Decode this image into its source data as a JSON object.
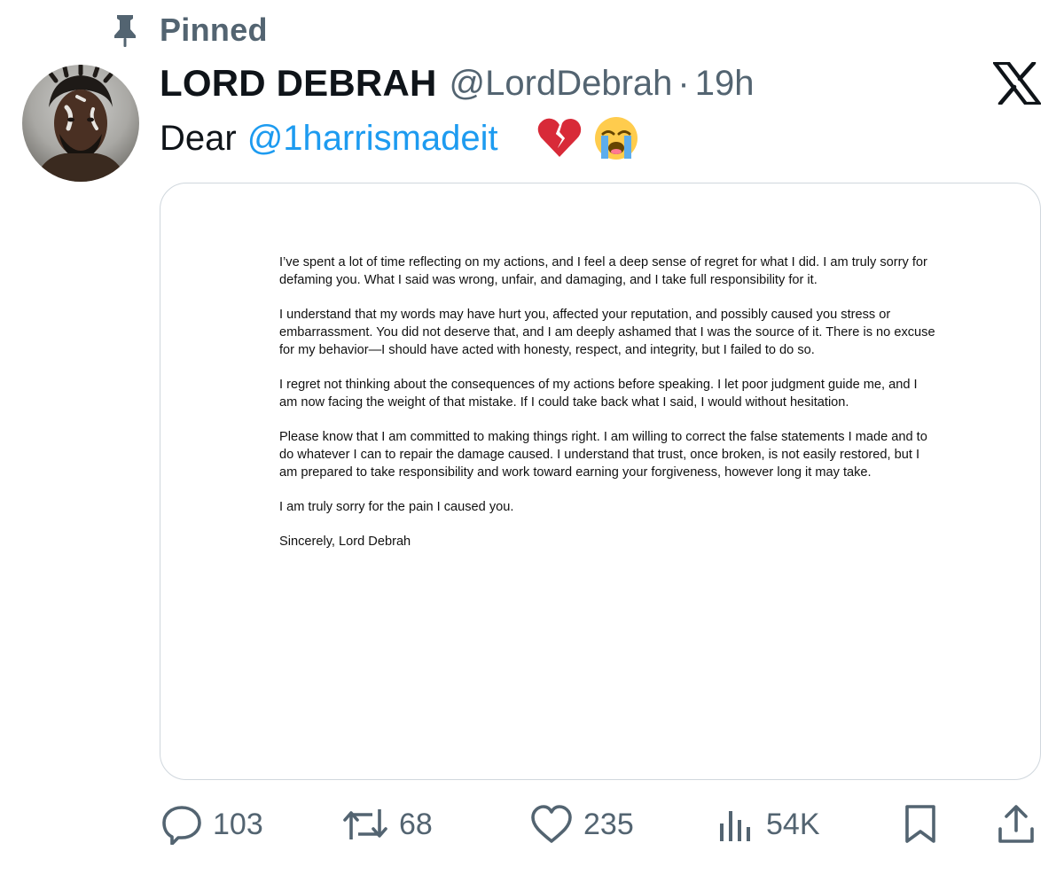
{
  "pinned": {
    "label": "Pinned",
    "icon": "pin-icon"
  },
  "author": {
    "display_name": "LORD DEBRAH",
    "handle": "@LordDebrah",
    "separator": "·",
    "time": "19h"
  },
  "brand": {
    "icon": "x-logo-icon"
  },
  "tweet": {
    "prefix": "Dear",
    "mention": "@1harrismadeit",
    "emojis": [
      "broken-heart-emoji",
      "loudly-crying-face-emoji"
    ]
  },
  "letter": {
    "paragraphs": [
      "I’ve spent a lot of time reflecting on my actions, and I feel a deep sense of regret for what I did. I am truly sorry for defaming you. What I said was wrong, unfair, and damaging, and I take full responsibility for it.",
      "I understand that my words may have hurt you, affected your reputation, and possibly caused you stress or embarrassment. You did not deserve that, and I am deeply ashamed that I was the source of it. There is no excuse for my behavior—I should have acted with honesty, respect, and integrity, but I failed to do so.",
      "I regret not thinking about the consequences of my actions before speaking. I let poor judgment guide me, and I am now facing the weight of that mistake. If I could take back what I said, I would without hesitation.",
      "Please know that I am committed to making things right. I am willing to correct the false statements I made and to do whatever I can to repair the damage caused. I understand that trust, once broken, is not easily restored, but I am prepared to take responsibility and work toward earning your forgiveness, however long it may take.",
      "I am truly sorry for the pain I caused you.",
      "Sincerely, Lord Debrah"
    ]
  },
  "actions": {
    "reply": {
      "count": "103",
      "icon": "reply-icon"
    },
    "repost": {
      "count": "68",
      "icon": "repost-icon"
    },
    "like": {
      "count": "235",
      "icon": "heart-icon"
    },
    "views": {
      "count": "54K",
      "icon": "views-icon"
    },
    "bookmark": {
      "icon": "bookmark-icon"
    },
    "share": {
      "icon": "share-icon"
    }
  },
  "colors": {
    "text": "#0f1419",
    "secondary": "#536471",
    "link": "#1d9bf0",
    "border": "#d0d7dd"
  }
}
